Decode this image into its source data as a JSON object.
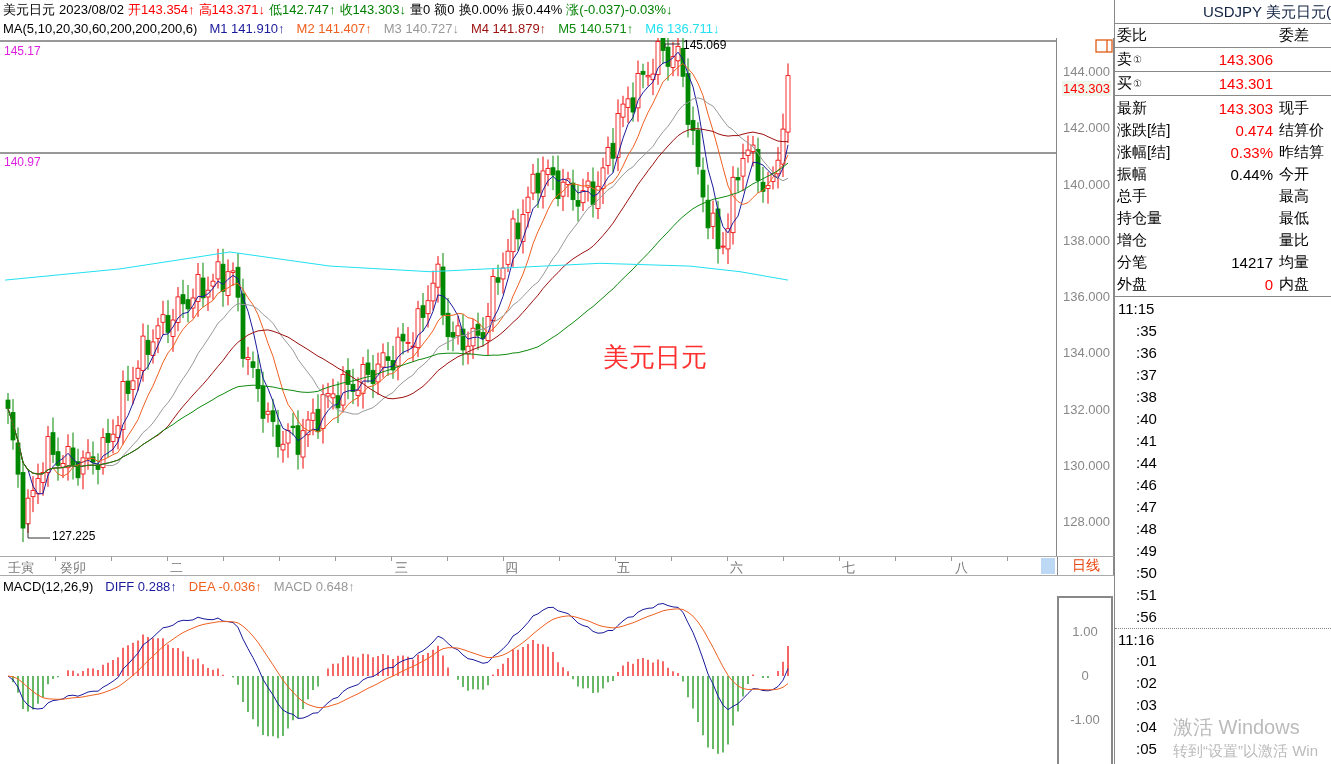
{
  "header": {
    "name": "美元日元",
    "date": "2023/08/02",
    "fields": [
      {
        "text": "开143.354↑",
        "color": "#ff0000"
      },
      {
        "text": "高143.371↓",
        "color": "#ff0000"
      },
      {
        "text": "低142.747↑",
        "color": "#008000"
      },
      {
        "text": "收143.303↓",
        "color": "#008000"
      },
      {
        "text": "量0"
      },
      {
        "text": "额0"
      },
      {
        "text": "换0.00%"
      },
      {
        "text": "振0.44%"
      },
      {
        "text": "涨(-0.037)-0.03%↓",
        "color": "#008000"
      }
    ]
  },
  "ma": {
    "label": "MA(5,10,20,30,60,200,200,200,6)",
    "lines": [
      {
        "text": "M1 141.910↑",
        "color": "#1a1a9c"
      },
      {
        "text": "M2 141.407↑",
        "color": "#f06020"
      },
      {
        "text": "M3 140.727↓",
        "color": "#999999"
      },
      {
        "text": "M4 141.879↑",
        "color": "#9c1010"
      },
      {
        "text": "M5 140.571↑",
        "color": "#108a10"
      },
      {
        "text": "M6 136.711↓",
        "color": "#22e0f0"
      }
    ]
  },
  "chart": {
    "reference_lines": [
      "145.17",
      "140.97"
    ],
    "high_label": "145.069",
    "low_label": "127.225",
    "title_overlay": "美元日元",
    "y_axis": [
      "144.000",
      "142.000",
      "140.000",
      "138.000",
      "136.000",
      "134.000",
      "132.000",
      "130.000",
      "128.000"
    ],
    "price_tag": "143.303"
  },
  "month_axis": {
    "labels": [
      "壬寅",
      "癸卯",
      "二",
      "三",
      "四",
      "五",
      "六",
      "七",
      "八"
    ],
    "period": "日线"
  },
  "macd": {
    "label": "MACD(12,26,9)",
    "fields": [
      {
        "text": "DIFF 0.288↑",
        "color": "#1a1a9c"
      },
      {
        "text": "DEA -0.036↑",
        "color": "#f06020"
      },
      {
        "text": "MACD 0.648↑",
        "color": "#999999"
      }
    ],
    "y_axis": [
      "1.00",
      "0",
      "-1.00"
    ]
  },
  "quote": {
    "title": "USDJPY 美元日元(",
    "ratio_label": "委比",
    "diff_label": "委差",
    "book": [
      {
        "side": "卖",
        "tier": "①",
        "price": "143.306"
      },
      {
        "side": "买",
        "tier": "①",
        "price": "143.301"
      }
    ],
    "rows": [
      {
        "label": "最新",
        "value": "143.303",
        "color": "#ff0000",
        "label2": "现手"
      },
      {
        "label": "涨跌[结]",
        "value": "0.474",
        "color": "#ff0000",
        "label2": "结算价"
      },
      {
        "label": "涨幅[结]",
        "value": "0.33%",
        "color": "#ff0000",
        "label2": "昨结算"
      },
      {
        "label": "振幅",
        "value": "0.44%",
        "label2": "今开"
      },
      {
        "label": "总手",
        "label2": "最高"
      },
      {
        "label": "持仓量",
        "label2": "最低"
      },
      {
        "label": "增仓",
        "label2": "量比"
      },
      {
        "label": "分笔",
        "value": "14217",
        "label2": "均量"
      },
      {
        "label": "外盘",
        "value": "0",
        "color": "#ff0000",
        "label2": "内盘"
      }
    ]
  },
  "ticks": [
    {
      "time": "11:15",
      "kind": "hour"
    },
    {
      "time": ":35",
      "kind": "minute"
    },
    {
      "time": ":36",
      "kind": "minute"
    },
    {
      "time": ":37",
      "kind": "minute"
    },
    {
      "time": ":38",
      "kind": "minute"
    },
    {
      "time": ":40",
      "kind": "minute"
    },
    {
      "time": ":41",
      "kind": "minute"
    },
    {
      "time": ":44",
      "kind": "minute"
    },
    {
      "time": ":46",
      "kind": "minute"
    },
    {
      "time": ":47",
      "kind": "minute"
    },
    {
      "time": ":48",
      "kind": "minute"
    },
    {
      "time": ":49",
      "kind": "minute"
    },
    {
      "time": ":50",
      "kind": "minute"
    },
    {
      "time": ":51",
      "kind": "minute"
    },
    {
      "time": ":56",
      "kind": "minute"
    },
    {
      "time": "11:16",
      "kind": "hour"
    },
    {
      "time": ":01",
      "kind": "minute"
    },
    {
      "time": ":02",
      "kind": "minute"
    },
    {
      "time": ":03",
      "kind": "minute"
    },
    {
      "time": ":04",
      "kind": "minute"
    },
    {
      "time": ":05",
      "kind": "minute"
    }
  ],
  "os_notice": {
    "title": "激活 Windows",
    "hint": "转到“设置”以激活 Win"
  }
}
